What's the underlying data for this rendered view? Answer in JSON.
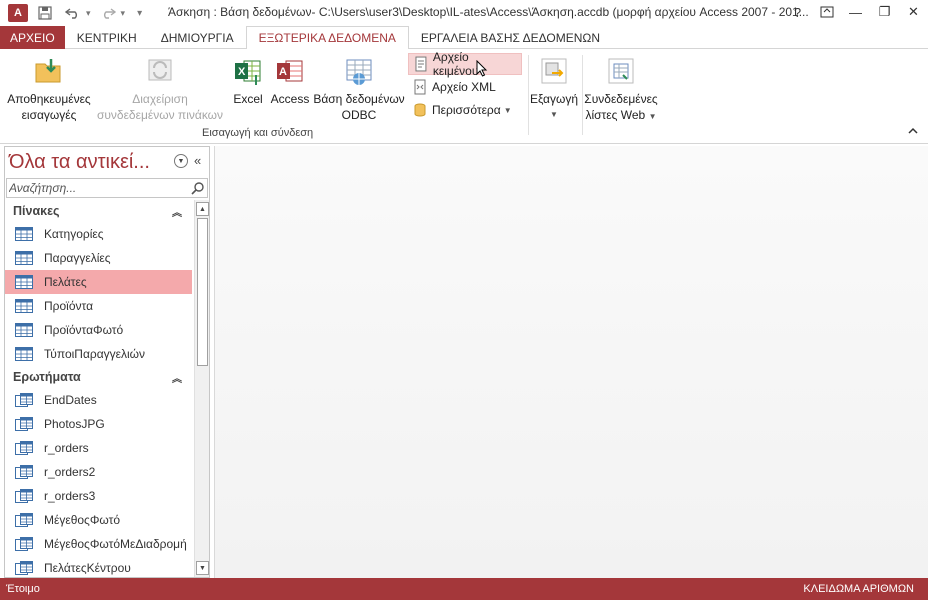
{
  "titlebar": {
    "app_icon_text": "A",
    "title": "Άσκηση : Βάση δεδομένων- C:\\Users\\user3\\Desktop\\IL-ates\\Access\\Άσκηση.accdb (μορφή αρχείου Access 2007 - 201...",
    "help": "?",
    "restore_icon": "ribbon-display-icon",
    "minimize": "—",
    "maximize": "❐",
    "close": "✕"
  },
  "tabs": [
    {
      "label": "ΑΡΧΕΙΟ"
    },
    {
      "label": "ΚΕΝΤΡΙΚΗ"
    },
    {
      "label": "ΔΗΜΙΟΥΡΓΙΑ"
    },
    {
      "label": "ΕΞΩΤΕΡΙΚΑ ΔΕΔΟΜΕΝΑ"
    },
    {
      "label": "ΕΡΓΑΛΕΙΑ ΒΑΣΗΣ ΔΕΔΟΜΕΝΩΝ"
    }
  ],
  "ribbon": {
    "saved_imports": {
      "line1": "Αποθηκευμένες",
      "line2": "εισαγωγές"
    },
    "linked_table_manager": {
      "line1": "Διαχείριση",
      "line2": "συνδεδεμένων πινάκων"
    },
    "excel": "Excel",
    "access": "Access",
    "odbc": {
      "line1": "Βάση δεδομένων",
      "line2": "ODBC"
    },
    "text_file": "Αρχείο κειμένου",
    "xml_file": "Αρχείο XML",
    "more": "Περισσότερα",
    "import_group_label": "Εισαγωγή και σύνδεση",
    "export": "Εξαγωγή",
    "web_lists": {
      "line1": "Συνδεδεμένες",
      "line2": "λίστες Web"
    }
  },
  "nav": {
    "title": "Όλα τα αντικεί...",
    "search_placeholder": "Αναζήτηση...",
    "groups": [
      {
        "label": "Πίνακες",
        "items": [
          "Κατηγορίες",
          "Παραγγελίες",
          "Πελάτες",
          "Προϊόντα",
          "ΠροϊόνταΦωτό",
          "ΤύποιΠαραγγελιών"
        ]
      },
      {
        "label": "Ερωτήματα",
        "items": [
          "EndDates",
          "PhotosJPG",
          "r_orders",
          "r_orders2",
          "r_orders3",
          "ΜέγεθοςΦωτό",
          "ΜέγεθοςΦωτόΜεΔιαδρομή",
          "ΠελάτεςΚέντρου"
        ]
      }
    ],
    "selected_item": "Πελάτες"
  },
  "status": {
    "left": "Έτοιμο",
    "right": "ΚΛΕΙΔΩΜΑ ΑΡΙΘΜΩΝ"
  },
  "colors": {
    "accent": "#a4373a",
    "selected": "#f4a9ab",
    "hover": "#f7d6d6"
  }
}
